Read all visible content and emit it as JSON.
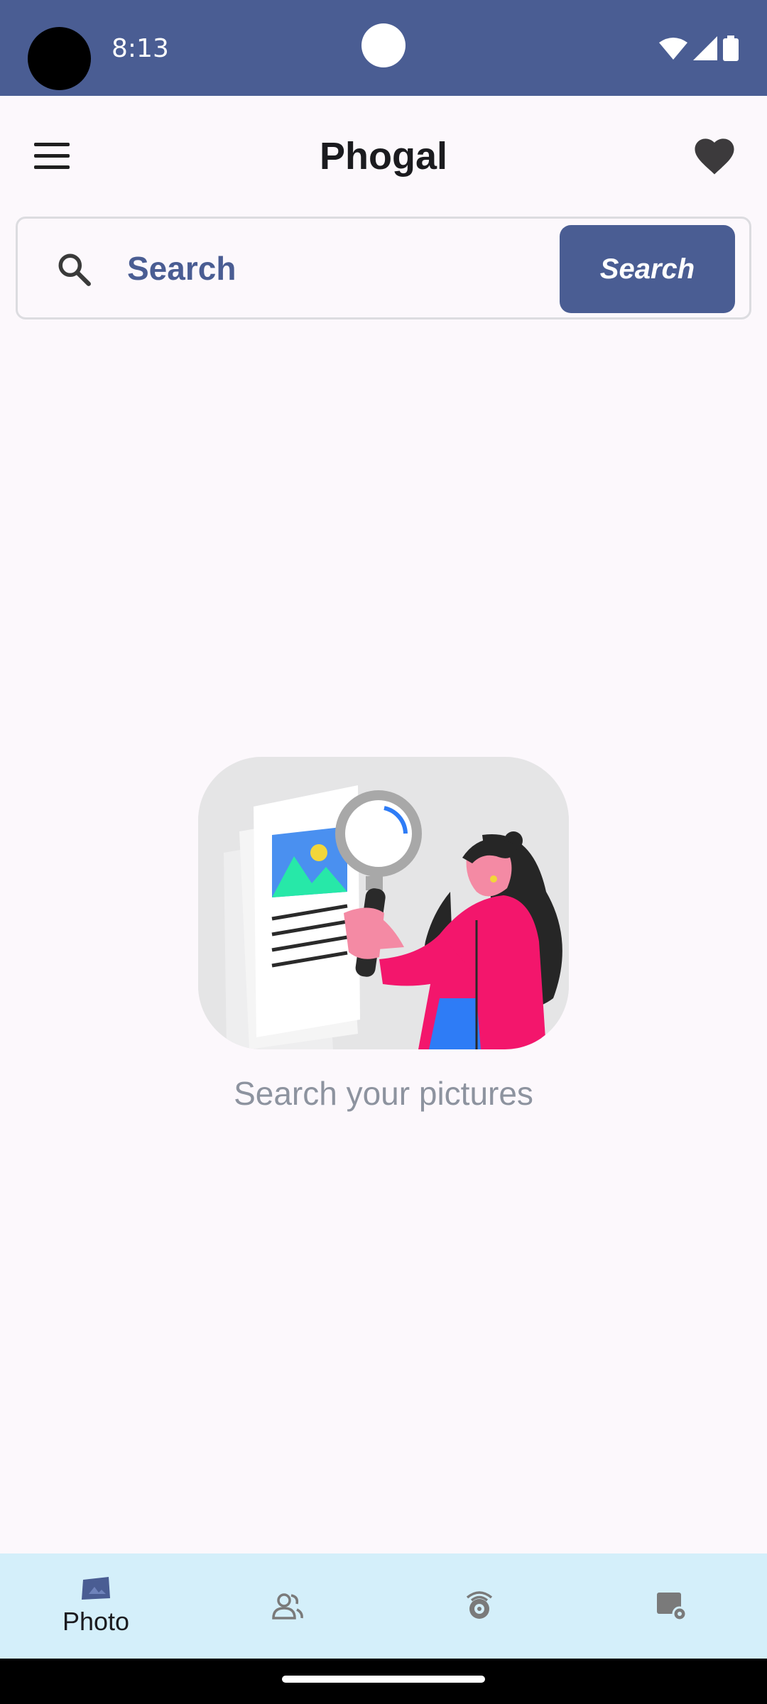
{
  "status_bar": {
    "time": "8:13",
    "icons": [
      "wifi-icon",
      "signal-icon",
      "battery-icon"
    ],
    "background": "#4A5D93"
  },
  "app_bar": {
    "title": "Phogal",
    "menu_icon": "menu-icon",
    "favorite_icon": "heart-icon"
  },
  "search": {
    "placeholder": "Search",
    "button_label": "Search",
    "accent": "#4A5D93"
  },
  "empty_state": {
    "message": "Search your pictures"
  },
  "bottom_nav": {
    "items": [
      {
        "label": "Photo",
        "icon": "photo-icon",
        "selected": true
      },
      {
        "icon": "people-icon"
      },
      {
        "icon": "camera-icon"
      },
      {
        "icon": "settings-icon"
      }
    ],
    "background": "#D4EFFA"
  }
}
